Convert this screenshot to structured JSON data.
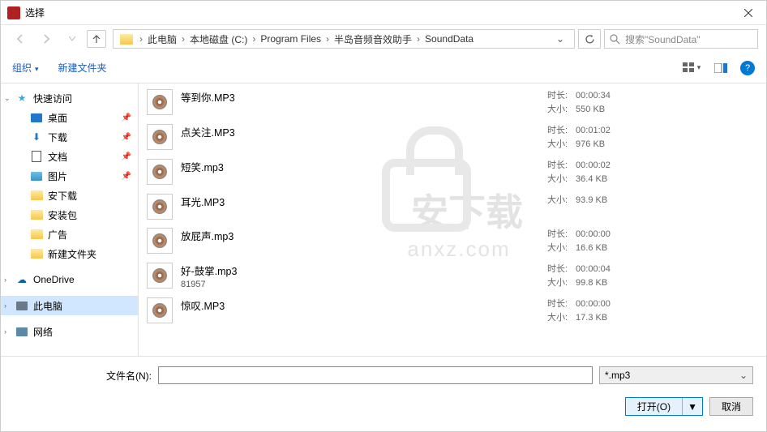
{
  "window": {
    "title": "选择"
  },
  "breadcrumb": {
    "items": [
      "此电脑",
      "本地磁盘 (C:)",
      "Program Files",
      "半岛音频音效助手",
      "SoundData"
    ]
  },
  "search": {
    "placeholder": "搜索\"SoundData\""
  },
  "toolbar": {
    "organize": "组织",
    "newfolder": "新建文件夹"
  },
  "sidebar": {
    "quickaccess": "快速访问",
    "desktop": "桌面",
    "downloads": "下载",
    "documents": "文档",
    "pictures": "图片",
    "anxiazai": "安下载",
    "anzhuangbao": "安装包",
    "guanggao": "广告",
    "newfolder": "新建文件夹",
    "onedrive": "OneDrive",
    "thispc": "此电脑",
    "network": "网络"
  },
  "meta_labels": {
    "duration": "时长:",
    "size": "大小:"
  },
  "files": [
    {
      "name": "等到你.MP3",
      "duration": "00:00:34",
      "size": "550 KB"
    },
    {
      "name": "点关注.MP3",
      "duration": "00:01:02",
      "size": "976 KB"
    },
    {
      "name": "短笑.mp3",
      "duration": "00:00:02",
      "size": "36.4 KB"
    },
    {
      "name": "耳光.MP3",
      "duration": "",
      "size": "93.9 KB"
    },
    {
      "name": "放屁声.mp3",
      "duration": "00:00:00",
      "size": "16.6 KB"
    },
    {
      "name": "好-鼓掌.mp3",
      "sub": "81957",
      "duration": "00:00:04",
      "size": "99.8 KB"
    },
    {
      "name": "惊叹.MP3",
      "duration": "00:00:00",
      "size": "17.3 KB"
    }
  ],
  "footer": {
    "filename_label": "文件名(N):",
    "filetype": "*.mp3",
    "open": "打开(O)",
    "cancel": "取消"
  },
  "watermark": {
    "t1": "安下载",
    "t2": "anxz.com"
  }
}
